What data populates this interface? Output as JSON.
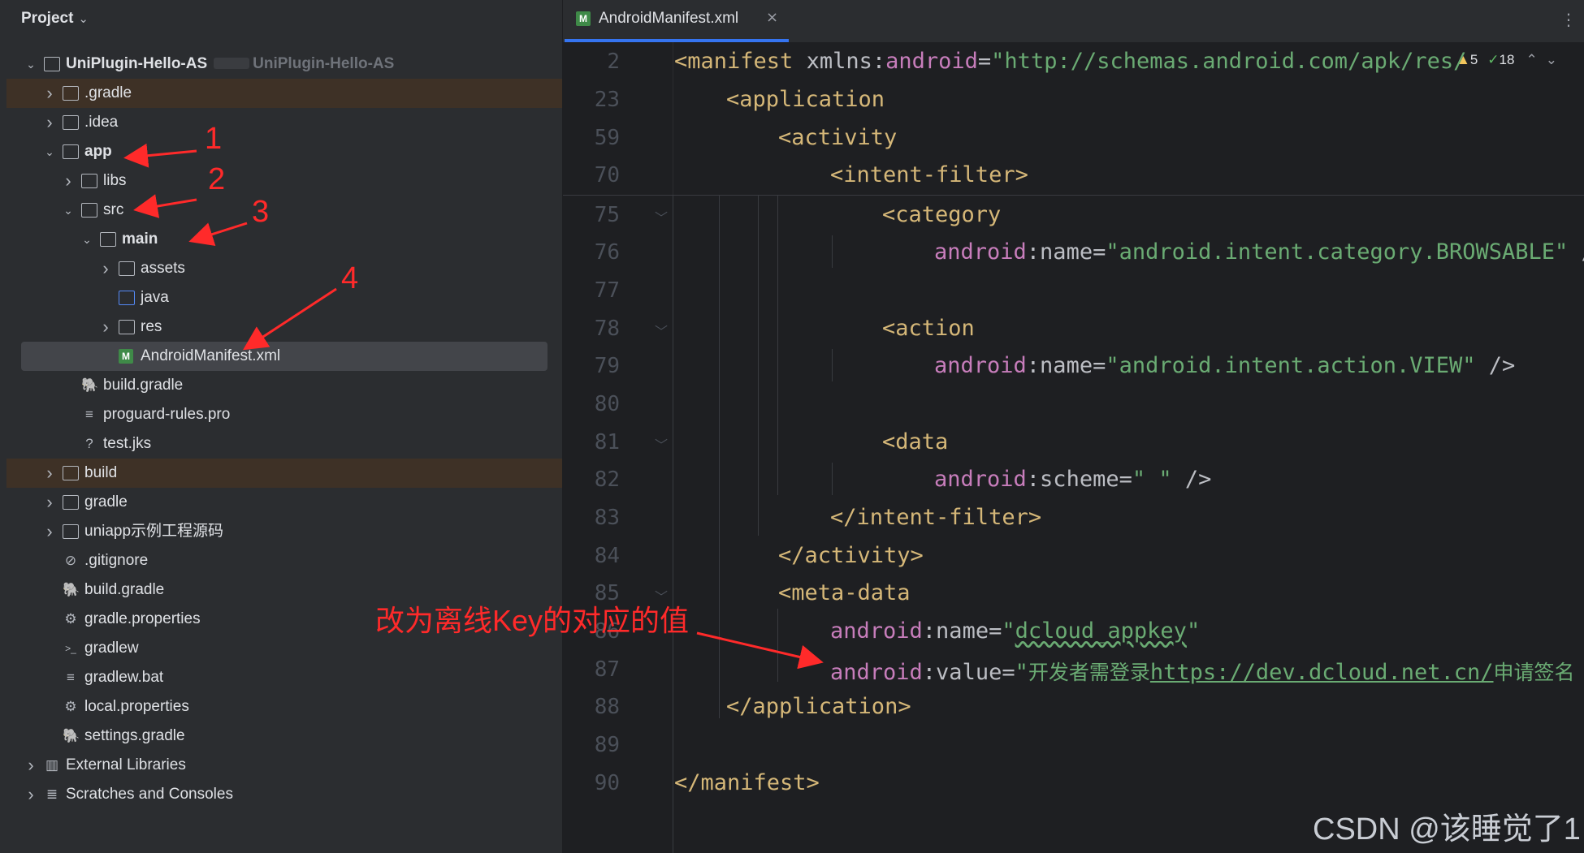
{
  "project": {
    "title": "Project",
    "chevron": "⌄"
  },
  "tree": [
    {
      "label": "UniPlugin-Hello-AS",
      "path": "UniPlugin-Hello-AS",
      "icon": "module-folder-icon",
      "arrow": "open",
      "bold": true
    },
    {
      "label": ".gradle",
      "icon": "folder-icon",
      "arrow": "closed"
    },
    {
      "label": ".idea",
      "icon": "folder-icon",
      "arrow": "closed"
    },
    {
      "label": "app",
      "icon": "module-folder-icon",
      "arrow": "open",
      "bold": true
    },
    {
      "label": "libs",
      "icon": "folder-icon",
      "arrow": "closed"
    },
    {
      "label": "src",
      "icon": "folder-icon",
      "arrow": "open"
    },
    {
      "label": "main",
      "icon": "module-folder-icon",
      "arrow": "open",
      "bold": true
    },
    {
      "label": "assets",
      "icon": "resource-folder-icon",
      "arrow": "closed"
    },
    {
      "label": "java",
      "icon": "source-folder-icon",
      "arrow": ""
    },
    {
      "label": "res",
      "icon": "resource-folder-icon",
      "arrow": "closed"
    },
    {
      "label": "AndroidManifest.xml",
      "icon": "xml-file-icon",
      "arrow": ""
    },
    {
      "label": "build.gradle",
      "icon": "gradle-icon",
      "arrow": ""
    },
    {
      "label": "proguard-rules.pro",
      "icon": "text-file-icon",
      "arrow": ""
    },
    {
      "label": "test.jks",
      "icon": "unknown-file-icon",
      "arrow": ""
    },
    {
      "label": "build",
      "icon": "folder-icon",
      "arrow": "closed"
    },
    {
      "label": "gradle",
      "icon": "folder-icon",
      "arrow": "closed"
    },
    {
      "label": "uniapp示例工程源码",
      "icon": "folder-icon",
      "arrow": "closed"
    },
    {
      "label": ".gitignore",
      "icon": "ignore-file-icon",
      "arrow": ""
    },
    {
      "label": "build.gradle",
      "icon": "gradle-icon",
      "arrow": ""
    },
    {
      "label": "gradle.properties",
      "icon": "settings-icon",
      "arrow": ""
    },
    {
      "label": "gradlew",
      "icon": "terminal-icon",
      "arrow": ""
    },
    {
      "label": "gradlew.bat",
      "icon": "text-file-icon",
      "arrow": ""
    },
    {
      "label": "local.properties",
      "icon": "settings-icon",
      "arrow": ""
    },
    {
      "label": "settings.gradle",
      "icon": "gradle-icon",
      "arrow": ""
    },
    {
      "label": "External Libraries",
      "icon": "library-icon",
      "arrow": "closed"
    },
    {
      "label": "Scratches and Consoles",
      "icon": "scratches-icon",
      "arrow": "closed"
    }
  ],
  "editor": {
    "tab_label": "AndroidManifest.xml",
    "tab_icon_letter": "M",
    "close_glyph": "×",
    "kebab": "⋮",
    "inspections": {
      "warnings": "5",
      "weak_warnings": "18"
    }
  },
  "lines": [
    {
      "n": "2"
    },
    {
      "n": "23"
    },
    {
      "n": "59"
    },
    {
      "n": "70"
    },
    {
      "n": "75"
    },
    {
      "n": "76"
    },
    {
      "n": "77"
    },
    {
      "n": "78"
    },
    {
      "n": "79"
    },
    {
      "n": "80"
    },
    {
      "n": "81"
    },
    {
      "n": "82"
    },
    {
      "n": "83"
    },
    {
      "n": "84"
    },
    {
      "n": "85"
    },
    {
      "n": "86"
    },
    {
      "n": "87"
    },
    {
      "n": "88"
    },
    {
      "n": "89"
    },
    {
      "n": "90"
    }
  ],
  "code": {
    "l2_tag": "<manifest",
    "l2_xmlns": " xmlns:",
    "l2_ns": "android",
    "l2_eq": "=",
    "l2_val": "\"http://schemas.android.com/apk/res/",
    "l23": "<application",
    "l59": "<activity",
    "l70": "<intent-filter>",
    "l75": "<category",
    "l76_ns": "android",
    "l76_attr": ":name=",
    "l76_val": "\"android.intent.category.BROWSABLE\"",
    "l76_end": " /",
    "l78": "<action",
    "l79_ns": "android",
    "l79_attr": ":name=",
    "l79_val": "\"android.intent.action.VIEW\"",
    "l79_end": " />",
    "l81": "<data",
    "l82_ns": "android",
    "l82_attr": ":scheme=",
    "l82_val": "\" \"",
    "l82_end": " />",
    "l83": "</intent-filter>",
    "l84": "</activity>",
    "l85": "<meta-data",
    "l86_ns": "android",
    "l86_attr": ":name=",
    "l86_q1": "\"",
    "l86_val": "dcloud_appkey",
    "l86_q2": "\"",
    "l87_ns": "android",
    "l87_attr": ":value=",
    "l87_q": "\"",
    "l87_cn1": "开发者需登录",
    "l87_link": "https://dev.dcloud.net.cn/",
    "l87_cn2": "申请签名",
    "l88": "</application>",
    "l90": "</manifest>"
  },
  "annotations": {
    "n1": "1",
    "n2": "2",
    "n3": "3",
    "n4": "4",
    "note": "改为离线Key的对应的值",
    "color": "#ff2a2a"
  },
  "watermark": "CSDN @该睡觉了1"
}
